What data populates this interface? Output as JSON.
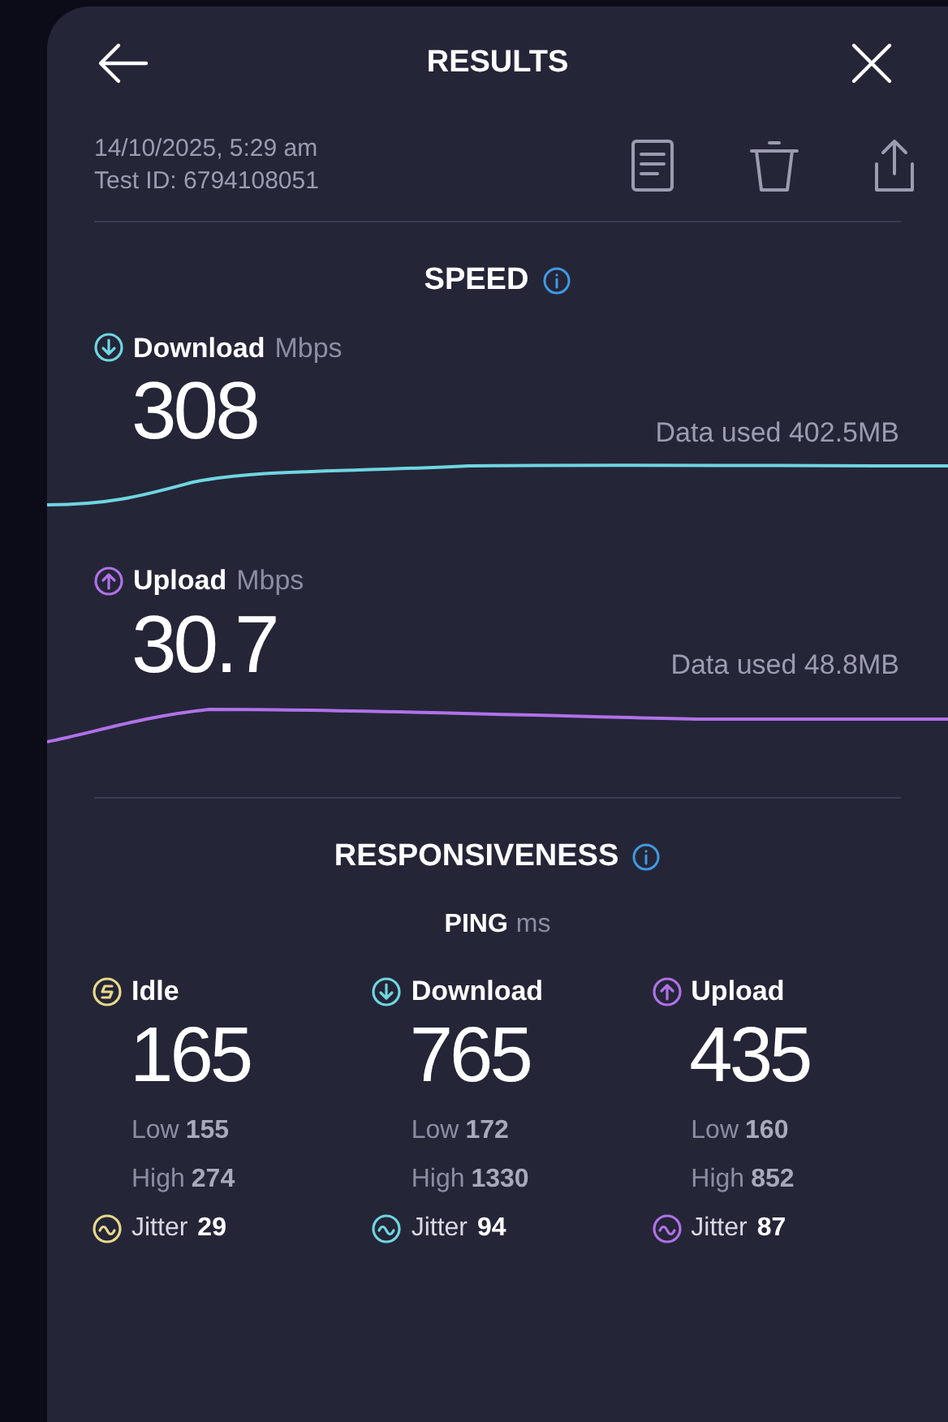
{
  "header": {
    "title": "RESULTS"
  },
  "meta": {
    "date": "14/10/2025, 5:29 am",
    "test_id": "Test ID: 6794108051"
  },
  "speed": {
    "title": "SPEED",
    "items": [
      {
        "kind": "download",
        "label": "Download",
        "unit": "Mbps",
        "value": "308",
        "data_used": "Data used 402.5MB",
        "color": "#6fd6e0"
      },
      {
        "kind": "upload",
        "label": "Upload",
        "unit": "Mbps",
        "value": "30.7",
        "data_used": "Data used 48.8MB",
        "color": "#b072e8"
      }
    ]
  },
  "responsiveness": {
    "title": "RESPONSIVENESS",
    "ping_label": "PING",
    "ping_unit": "ms",
    "columns": [
      {
        "kind": "idle",
        "label": "Idle",
        "value": "165",
        "low_label": "Low",
        "low": "155",
        "high_label": "High",
        "high": "274",
        "jitter_label": "Jitter",
        "jitter": "29",
        "color": "#e8d98a"
      },
      {
        "kind": "download",
        "label": "Download",
        "value": "765",
        "low_label": "Low",
        "low": "172",
        "high_label": "High",
        "high": "1330",
        "jitter_label": "Jitter",
        "jitter": "94",
        "color": "#6fd6e0"
      },
      {
        "kind": "upload",
        "label": "Upload",
        "value": "435",
        "low_label": "Low",
        "low": "160",
        "high_label": "High",
        "high": "852",
        "jitter_label": "Jitter",
        "jitter": "87",
        "color": "#b072e8"
      }
    ]
  }
}
